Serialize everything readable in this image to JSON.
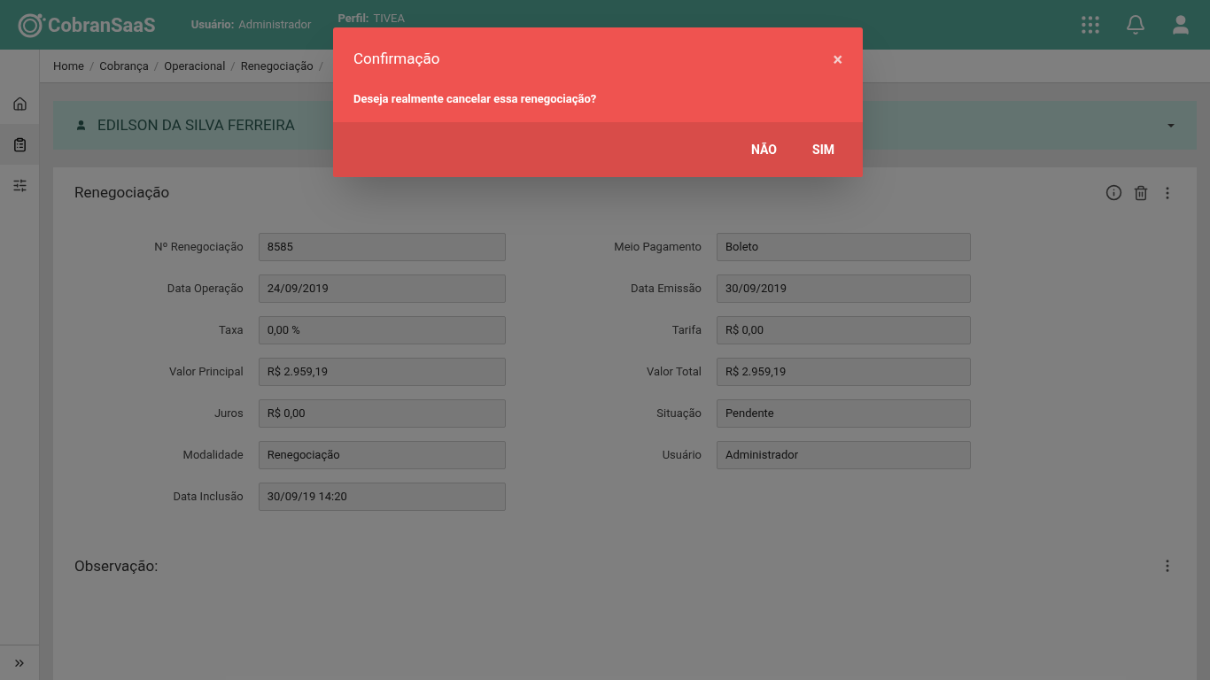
{
  "header": {
    "logo": "CobranSaaS",
    "user_label": "Usuário:",
    "user_value": "Administrador",
    "profile_label": "Perfil:",
    "profile_value": "TIVEA"
  },
  "breadcrumb": {
    "separator": "/",
    "items": [
      "Home",
      "Cobrança",
      "Operacional",
      "Renegociação"
    ]
  },
  "sidebar": {
    "items": [
      {
        "selected": false
      },
      {
        "selected": true
      },
      {
        "selected": false
      }
    ]
  },
  "client": {
    "name": "EDILSON DA SILVA FERREIRA"
  },
  "card": {
    "title": "Renegociação",
    "left_fields": [
      {
        "label": "Nº Renegociação",
        "value": "8585"
      },
      {
        "label": "Data Operação",
        "value": "24/09/2019"
      },
      {
        "label": "Taxa",
        "value": "0,00 %"
      },
      {
        "label": "Valor Principal",
        "value": "R$ 2.959,19"
      },
      {
        "label": "Juros",
        "value": "R$ 0,00"
      },
      {
        "label": "Modalidade",
        "value": "Renegociação"
      },
      {
        "label": "Data Inclusão",
        "value": "30/09/19 14:20"
      }
    ],
    "right_fields": [
      {
        "label": "Meio Pagamento",
        "value": "Boleto"
      },
      {
        "label": "Data Emissão",
        "value": "30/09/2019"
      },
      {
        "label": "Tarifa",
        "value": "R$ 0,00"
      },
      {
        "label": "Valor Total",
        "value": "R$ 2.959,19"
      },
      {
        "label": "Situação",
        "value": "Pendente"
      },
      {
        "label": "Usuário",
        "value": "Administrador"
      }
    ]
  },
  "observation": {
    "title": "Observação:"
  },
  "dialog": {
    "title": "Confirmação",
    "close": "×",
    "message": "Deseja realmente cancelar essa renegociação?",
    "buttons": [
      "NÃO",
      "SIM"
    ]
  }
}
